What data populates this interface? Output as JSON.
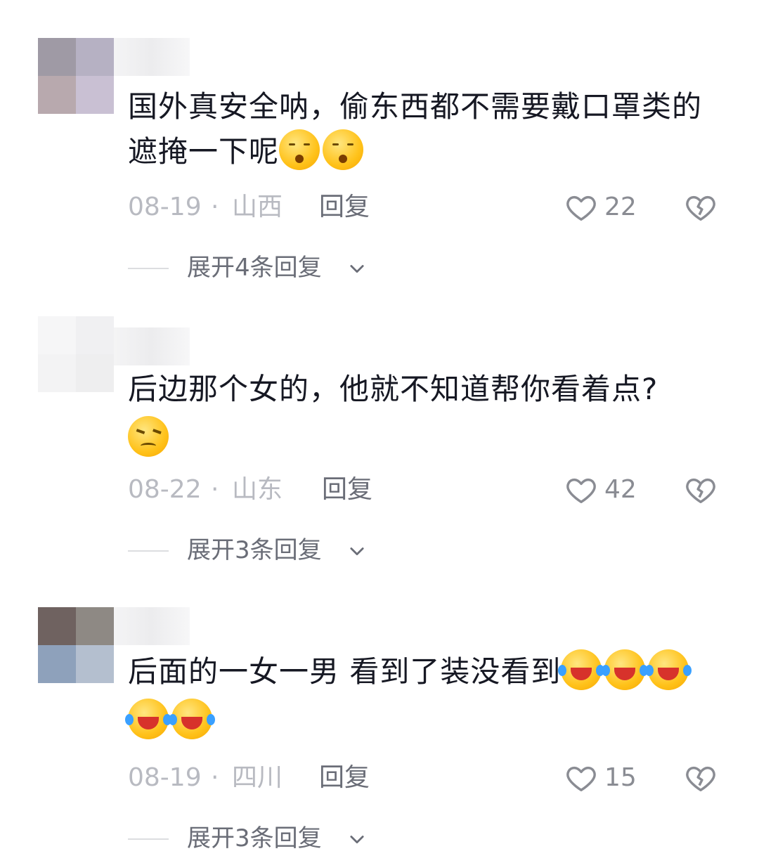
{
  "comments": [
    {
      "text": "国外真安全呐，偷东西都不需要戴口罩类的遮掩一下呢",
      "emojis": [
        "sleepy",
        "sleepy"
      ],
      "date": "08-19",
      "region": "山西",
      "reply_label": "回复",
      "likes": "22",
      "expand_label": "展开4条回复",
      "avatar_colors": [
        "#9f9aa5",
        "#b6b1c3",
        "#b8a9ae",
        "#c9c0d3"
      ]
    },
    {
      "text": "后边那个女的，他就不知道帮你看着点?",
      "emojis": [
        "angry"
      ],
      "date": "08-22",
      "region": "山东",
      "reply_label": "回复",
      "likes": "42",
      "expand_label": "展开3条回复",
      "avatar_colors": [
        "#f6f6f7",
        "#f0f0f2",
        "#f3f3f4",
        "#eeeeef"
      ]
    },
    {
      "text": "后面的一女一男 看到了装没看到",
      "emojis": [
        "laugh",
        "laugh",
        "laugh",
        "laugh",
        "laugh"
      ],
      "date": "08-19",
      "region": "四川",
      "reply_label": "回复",
      "likes": "15",
      "expand_label": "展开3条回复",
      "avatar_colors": [
        "#6f6260",
        "#8e8984",
        "#8ea1bb",
        "#b4bfcf"
      ]
    }
  ],
  "separator": "·",
  "icons": {
    "like": "heart-outline-icon",
    "dislike": "broken-heart-icon",
    "expand": "chevron-down-icon"
  }
}
